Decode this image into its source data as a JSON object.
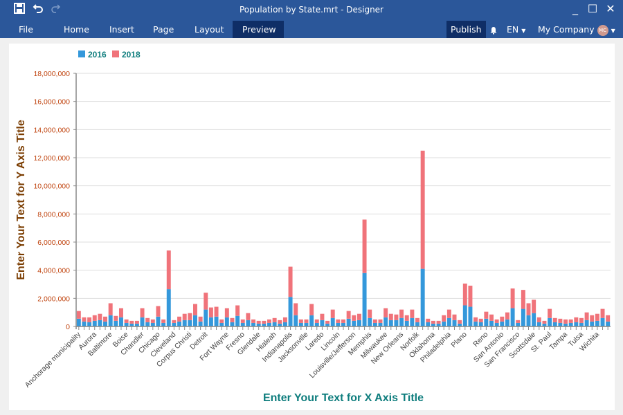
{
  "window": {
    "title": "Population by State.mrt - Designer",
    "quick_access": {
      "save_icon": "save-icon",
      "undo_icon": "undo-icon",
      "redo_icon": "redo-icon"
    },
    "controls": {
      "minimize": "_",
      "maximize": "☐",
      "close": "✕"
    }
  },
  "menu": {
    "tabs": [
      {
        "label": "File",
        "active": false
      },
      {
        "label": "Home",
        "active": false
      },
      {
        "label": "Insert",
        "active": false
      },
      {
        "label": "Page",
        "active": false
      },
      {
        "label": "Layout",
        "active": false
      },
      {
        "label": "Preview",
        "active": true
      }
    ],
    "publish_label": "Publish",
    "language": "EN",
    "company": "My Company",
    "avatar_initials": "MC"
  },
  "colors": {
    "series_2016": "#3498db",
    "series_2018": "#f0737a",
    "axis_label": "#c0440f",
    "x_title": "#0e7d7d",
    "y_title": "#7a3c00",
    "legend_text": "#0e7d7d"
  },
  "chart_data": {
    "type": "bar",
    "stacked": true,
    "title": "",
    "xlabel": "Enter Your Text for X Axis Title",
    "ylabel": "Enter Your Text for Y Axis Title",
    "ylim": [
      0,
      18000000
    ],
    "yticks": [
      "0",
      "2,000,000",
      "4,000,000",
      "6,000,000",
      "8,000,000",
      "10,000,000",
      "12,000,000",
      "14,000,000",
      "16,000,000",
      "18,000,000"
    ],
    "grid": true,
    "legend": {
      "position": "top-left",
      "entries": [
        "2016",
        "2018"
      ]
    },
    "visible_category_labels": [
      "Anchorage municipality",
      "Aurora",
      "Baltimore",
      "Boise",
      "Chandler",
      "Chicago",
      "Cleveland",
      "Corpus Christi",
      "Detroit",
      "Fort Wayne",
      "Fresno",
      "Glendale",
      "Hialeah",
      "Indianapolis",
      "Jacksonville",
      "Laredo",
      "Lincoln",
      "Louisville/Jefferson",
      "Memphis",
      "Milwaukee",
      "New Orleans",
      "Norfolk",
      "Oklahoma",
      "Philadelphia",
      "Plano",
      "Reno",
      "San Antonio",
      "San Francisco",
      "Scottsdale",
      "St. Paul",
      "Tampa",
      "Tulsa",
      "Wichita"
    ],
    "label_every": 3,
    "series": [
      {
        "name": "2016",
        "values": [
          550000,
          350000,
          300000,
          400000,
          450000,
          350000,
          800000,
          400000,
          650000,
          250000,
          200000,
          200000,
          650000,
          300000,
          250000,
          700000,
          250000,
          2650000,
          250000,
          350000,
          450000,
          450000,
          800000,
          350000,
          1200000,
          650000,
          700000,
          250000,
          650000,
          300000,
          750000,
          250000,
          450000,
          250000,
          200000,
          200000,
          250000,
          300000,
          200000,
          300000,
          2100000,
          800000,
          250000,
          250000,
          800000,
          250000,
          450000,
          200000,
          600000,
          250000,
          250000,
          550000,
          400000,
          450000,
          3800000,
          600000,
          250000,
          250000,
          650000,
          450000,
          450000,
          600000,
          400000,
          600000,
          300000,
          4100000,
          300000,
          200000,
          200000,
          350000,
          600000,
          450000,
          200000,
          1500000,
          1400000,
          350000,
          300000,
          550000,
          400000,
          250000,
          350000,
          500000,
          1300000,
          250000,
          1250000,
          800000,
          950000,
          300000,
          200000,
          600000,
          300000,
          250000,
          200000,
          250000,
          300000,
          250000,
          450000,
          350000,
          400000,
          600000,
          350000
        ]
      },
      {
        "name": "2018",
        "values": [
          550000,
          300000,
          350000,
          400000,
          450000,
          350000,
          850000,
          350000,
          650000,
          250000,
          200000,
          200000,
          650000,
          300000,
          250000,
          750000,
          250000,
          2750000,
          200000,
          350000,
          450000,
          500000,
          800000,
          350000,
          1200000,
          700000,
          700000,
          250000,
          650000,
          300000,
          750000,
          250000,
          500000,
          250000,
          200000,
          200000,
          250000,
          300000,
          250000,
          350000,
          2150000,
          850000,
          250000,
          250000,
          800000,
          250000,
          450000,
          200000,
          600000,
          250000,
          250000,
          550000,
          400000,
          450000,
          3800000,
          600000,
          250000,
          250000,
          650000,
          450000,
          400000,
          600000,
          400000,
          600000,
          300000,
          8400000,
          250000,
          200000,
          200000,
          450000,
          600000,
          400000,
          250000,
          1550000,
          1500000,
          300000,
          250000,
          500000,
          450000,
          250000,
          350000,
          500000,
          1400000,
          200000,
          1350000,
          850000,
          950000,
          350000,
          200000,
          650000,
          300000,
          300000,
          300000,
          250000,
          350000,
          350000,
          550000,
          450000,
          500000,
          650000,
          450000
        ]
      }
    ]
  }
}
